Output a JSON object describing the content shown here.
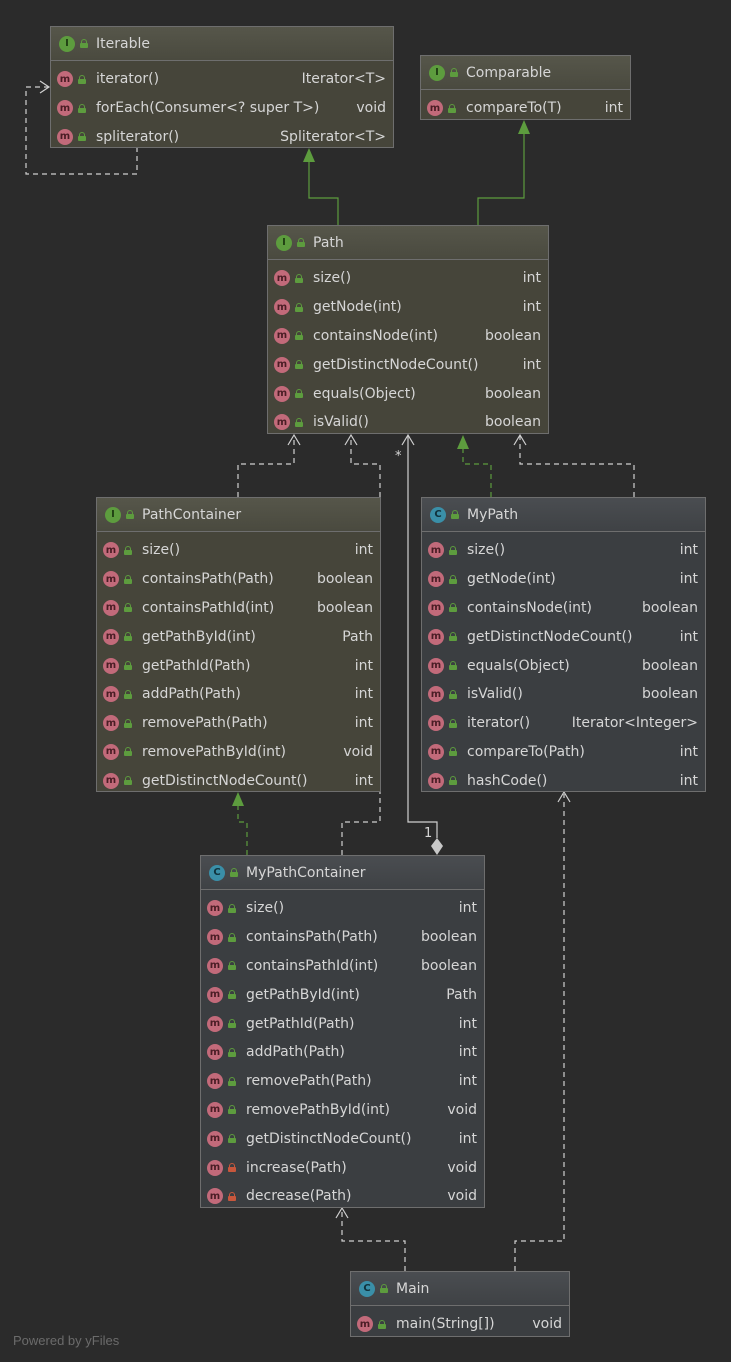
{
  "classes": {
    "iterable": {
      "kind": "I",
      "name": "Iterable",
      "methods": [
        {
          "name": "iterator()",
          "ret": "Iterator<T>"
        },
        {
          "name": "forEach(Consumer<? super T>)",
          "ret": "void"
        },
        {
          "name": "spliterator()",
          "ret": "Spliterator<T>"
        }
      ]
    },
    "comparable": {
      "kind": "I",
      "name": "Comparable",
      "methods": [
        {
          "name": "compareTo(T)",
          "ret": "int"
        }
      ]
    },
    "path": {
      "kind": "I",
      "name": "Path",
      "methods": [
        {
          "name": "size()",
          "ret": "int"
        },
        {
          "name": "getNode(int)",
          "ret": "int"
        },
        {
          "name": "containsNode(int)",
          "ret": "boolean"
        },
        {
          "name": "getDistinctNodeCount()",
          "ret": "int"
        },
        {
          "name": "equals(Object)",
          "ret": "boolean"
        },
        {
          "name": "isValid()",
          "ret": "boolean"
        }
      ]
    },
    "pathcontainer": {
      "kind": "I",
      "name": "PathContainer",
      "methods": [
        {
          "name": "size()",
          "ret": "int"
        },
        {
          "name": "containsPath(Path)",
          "ret": "boolean"
        },
        {
          "name": "containsPathId(int)",
          "ret": "boolean"
        },
        {
          "name": "getPathById(int)",
          "ret": "Path"
        },
        {
          "name": "getPathId(Path)",
          "ret": "int"
        },
        {
          "name": "addPath(Path)",
          "ret": "int"
        },
        {
          "name": "removePath(Path)",
          "ret": "int"
        },
        {
          "name": "removePathById(int)",
          "ret": "void"
        },
        {
          "name": "getDistinctNodeCount()",
          "ret": "int"
        }
      ]
    },
    "mypath": {
      "kind": "C",
      "name": "MyPath",
      "methods": [
        {
          "name": "size()",
          "ret": "int"
        },
        {
          "name": "getNode(int)",
          "ret": "int"
        },
        {
          "name": "containsNode(int)",
          "ret": "boolean"
        },
        {
          "name": "getDistinctNodeCount()",
          "ret": "int"
        },
        {
          "name": "equals(Object)",
          "ret": "boolean"
        },
        {
          "name": "isValid()",
          "ret": "boolean"
        },
        {
          "name": "iterator()",
          "ret": "Iterator<Integer>"
        },
        {
          "name": "compareTo(Path)",
          "ret": "int"
        },
        {
          "name": "hashCode()",
          "ret": "int"
        }
      ]
    },
    "mypathcontainer": {
      "kind": "C",
      "name": "MyPathContainer",
      "methods": [
        {
          "name": "size()",
          "ret": "int"
        },
        {
          "name": "containsPath(Path)",
          "ret": "boolean"
        },
        {
          "name": "containsPathId(int)",
          "ret": "boolean"
        },
        {
          "name": "getPathById(int)",
          "ret": "Path"
        },
        {
          "name": "getPathId(Path)",
          "ret": "int"
        },
        {
          "name": "addPath(Path)",
          "ret": "int"
        },
        {
          "name": "removePath(Path)",
          "ret": "int"
        },
        {
          "name": "removePathById(int)",
          "ret": "void"
        },
        {
          "name": "getDistinctNodeCount()",
          "ret": "int"
        },
        {
          "name": "increase(Path)",
          "ret": "void",
          "private": true
        },
        {
          "name": "decrease(Path)",
          "ret": "void",
          "private": true
        }
      ]
    },
    "main": {
      "kind": "C",
      "name": "Main",
      "methods": [
        {
          "name": "main(String[])",
          "ret": "void"
        }
      ]
    }
  },
  "multiplicities": {
    "many": "*",
    "one": "1"
  },
  "colors": {
    "background": "#2b2b2b",
    "realization": "#5d9c3e",
    "dependency": "#d0d0d0"
  },
  "footer": "Powered by yFiles"
}
